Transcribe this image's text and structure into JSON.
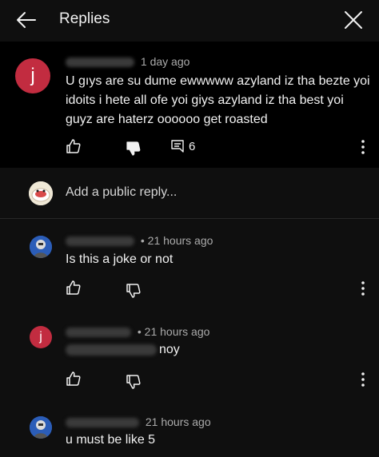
{
  "header": {
    "title": "Replies"
  },
  "parent_comment": {
    "avatar_letter": "j",
    "time": "1 day ago",
    "text": "U gıys are su dume ewwwww azyland iz tha bezte yoi idoits i hete all ofe yoi giys azyland iz tha best yoi guyz are haterz oooooo get roasted",
    "reply_count": "6"
  },
  "add_reply": {
    "placeholder": "Add a public reply..."
  },
  "replies": [
    {
      "avatar": "bot-avatar",
      "time": "• 21 hours ago",
      "text": "Is this a joke or not"
    },
    {
      "avatar_letter": "j",
      "time": "• 21 hours ago",
      "text": "noy"
    },
    {
      "avatar": "bot-avatar",
      "time": "21 hours ago",
      "text": "u must be like 5"
    }
  ],
  "colors": {
    "background": "#0f0f0f",
    "parent_bg": "#000000",
    "avatar_j": "#c22c40",
    "avatar_bot": "#2b5db8"
  }
}
